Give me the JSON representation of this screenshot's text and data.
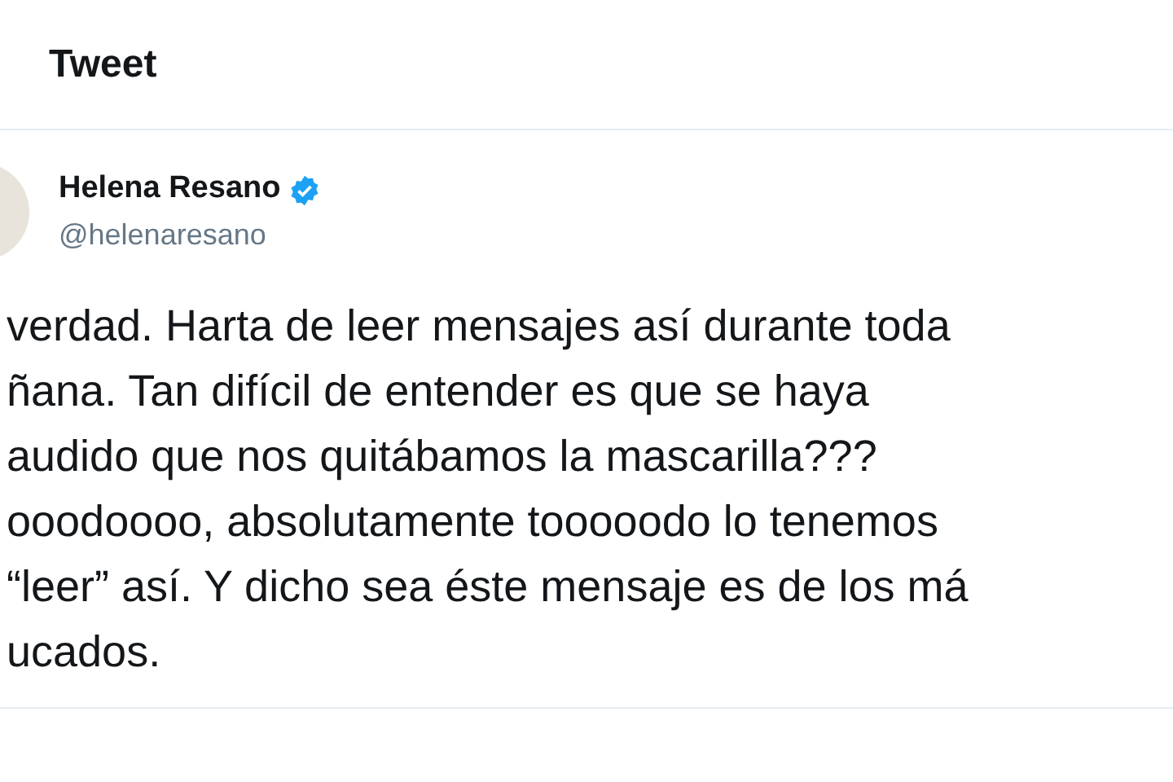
{
  "header": {
    "title": "Tweet"
  },
  "author": {
    "name": "Helena Resano",
    "verified": true,
    "handle": "@helenaresano"
  },
  "tweet_lines": [
    "verdad. Harta de leer mensajes así durante toda",
    "ñana. Tan difícil de entender es que se haya",
    "audido que nos quitábamos la mascarilla???",
    "ooodoooo, absolutamente tooooodo lo tenemos",
    "“leer” así. Y dicho sea éste mensaje es de los má",
    "ucados."
  ]
}
